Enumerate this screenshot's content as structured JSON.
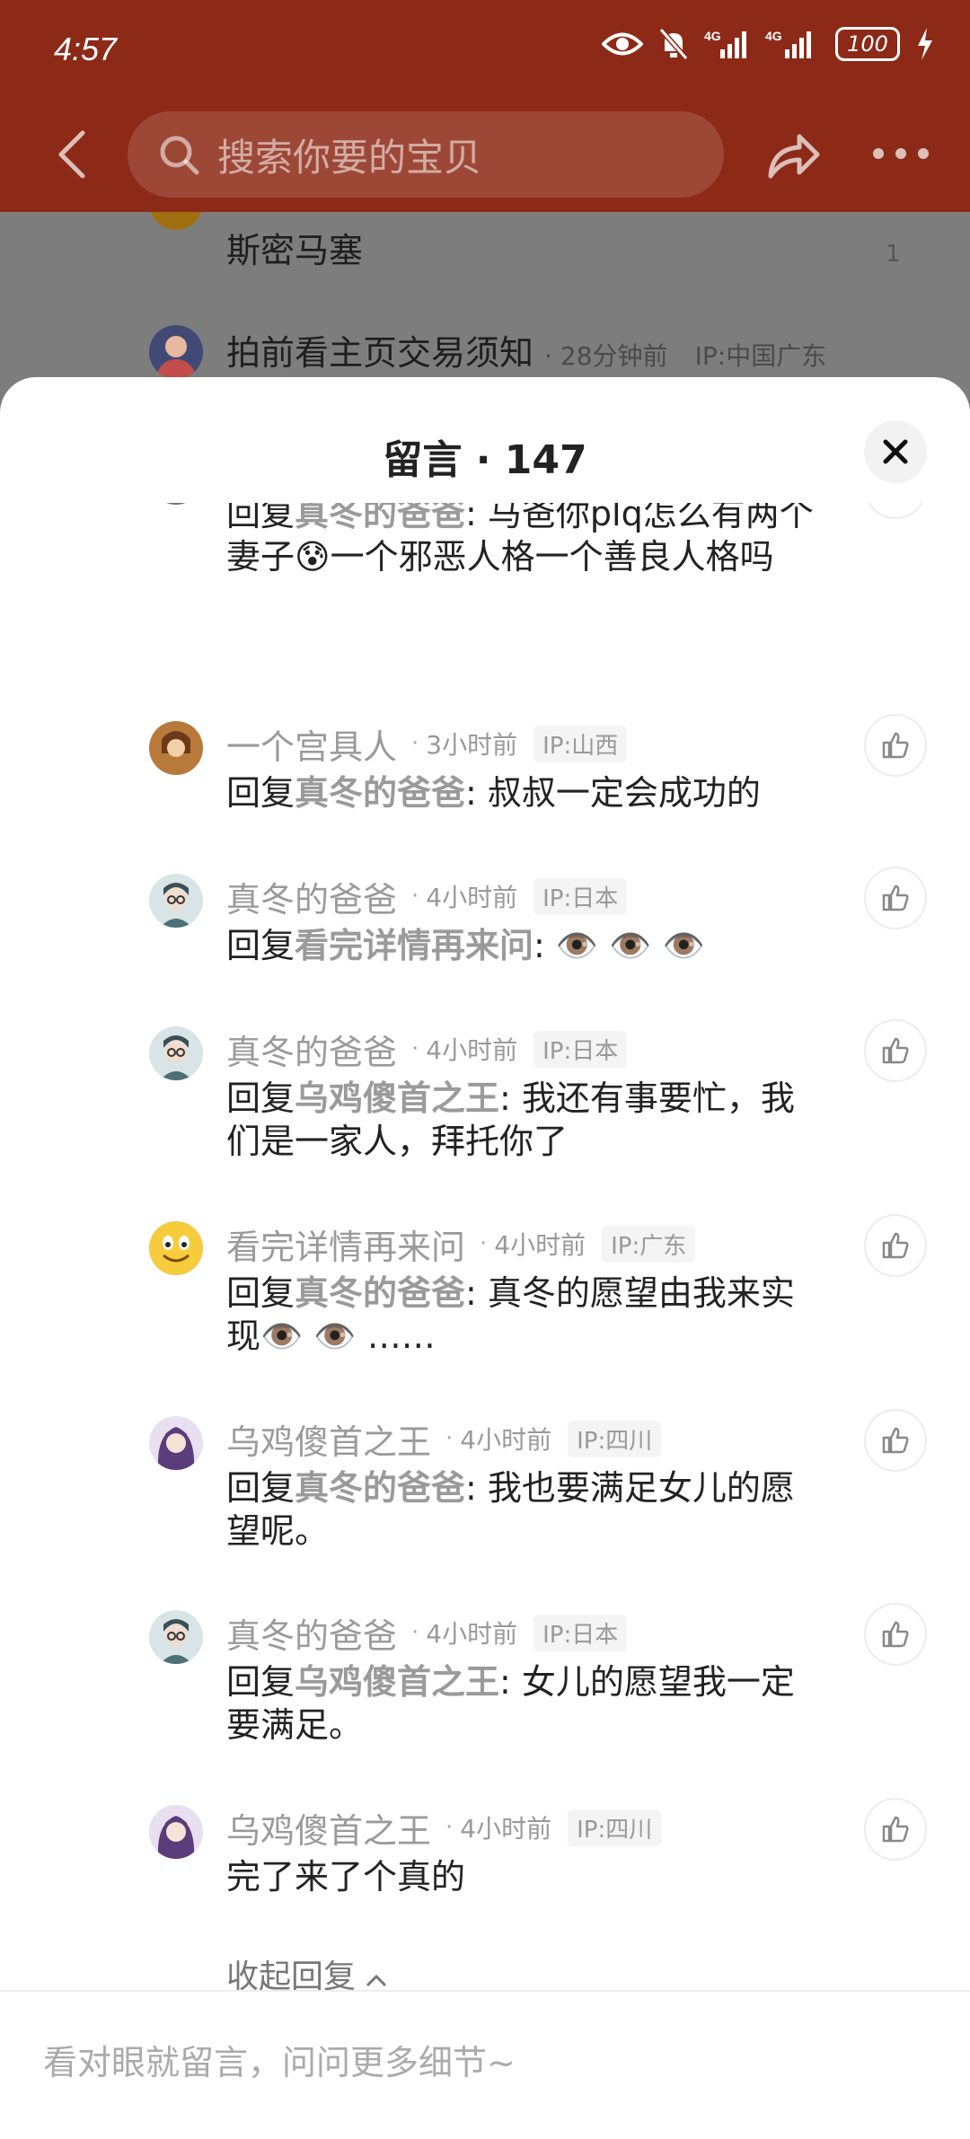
{
  "status_bar": {
    "time": "4:57",
    "battery": "100",
    "net1": "4G",
    "net2": "4G"
  },
  "nav": {
    "search_placeholder": "搜索你要的宝贝"
  },
  "background": {
    "row1_text": "斯密马塞",
    "row1_count": "1",
    "row2_name": "拍前看主页交易须知",
    "row2_time": "28分钟前",
    "row2_ip": "IP:中国广东"
  },
  "sheet": {
    "title": "留言 · 147",
    "collapse_label": "收起回复"
  },
  "comments": [
    {
      "avatar_color": "#6b6b9a",
      "reply_prefix": "回复",
      "reply_to": "真冬的爸爸",
      "text": ":   马爸你plq怎么有两个妻子😰一个邪恶人格一个善良人格吗"
    },
    {
      "name": "一个宫具人",
      "time": "3小时前",
      "ip": "IP:山西",
      "avatar_color": "#b77a3a",
      "reply_prefix": "回复",
      "reply_to": "真冬的爸爸",
      "text": ": 叔叔一定会成功的"
    },
    {
      "name": "真冬的爸爸",
      "time": "4小时前",
      "ip": "IP:日本",
      "avatar_color": "#4d6f77",
      "reply_prefix": "回复",
      "reply_to": "看完详情再来问",
      "text": ": 👁️ 👁️ 👁️"
    },
    {
      "name": "真冬的爸爸",
      "time": "4小时前",
      "ip": "IP:日本",
      "avatar_color": "#4d6f77",
      "reply_prefix": "回复",
      "reply_to": "乌鸡傻首之王",
      "text": ": 我还有事要忙，我们是一家人，拜托你了"
    },
    {
      "name": "看完详情再来问",
      "time": "4小时前",
      "ip": "IP:广东",
      "avatar_color": "#f5c542",
      "reply_prefix": "回复",
      "reply_to": "真冬的爸爸",
      "text": ": 真冬的愿望由我来实现👁️ 👁️ ……"
    },
    {
      "name": "乌鸡傻首之王",
      "time": "4小时前",
      "ip": "IP:四川",
      "avatar_color": "#6b4e8c",
      "reply_prefix": "回复",
      "reply_to": "真冬的爸爸",
      "text": ": 我也要满足女儿的愿望呢。"
    },
    {
      "name": "真冬的爸爸",
      "time": "4小时前",
      "ip": "IP:日本",
      "avatar_color": "#4d6f77",
      "reply_prefix": "回复",
      "reply_to": "乌鸡傻首之王",
      "text": ": 女儿的愿望我一定要满足。"
    },
    {
      "name": "乌鸡傻首之王",
      "time": "4小时前",
      "ip": "IP:四川",
      "avatar_color": "#6b4e8c",
      "reply_prefix": "",
      "reply_to": "",
      "text": "完了来了个真的"
    }
  ],
  "input": {
    "placeholder": "看对眼就留言，问问更多细节~"
  }
}
